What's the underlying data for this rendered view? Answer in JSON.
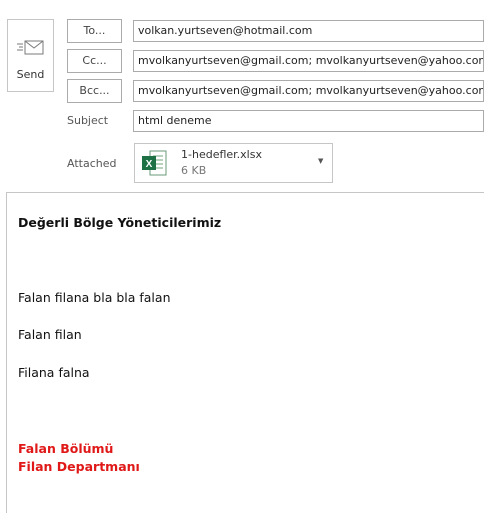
{
  "send": {
    "label": "Send",
    "icon": "send-envelope-icon"
  },
  "fields": {
    "to": {
      "button": "To...",
      "value": "volkan.yurtseven@hotmail.com"
    },
    "cc": {
      "button": "Cc...",
      "value": "mvolkanyurtseven@gmail.com; mvolkanyurtseven@yahoo.com.tr"
    },
    "bcc": {
      "button": "Bcc...",
      "value": "mvolkanyurtseven@gmail.com; mvolkanyurtseven@yahoo.com.tr"
    },
    "subject": {
      "label": "Subject",
      "value": "html deneme"
    },
    "attached": {
      "label": "Attached"
    }
  },
  "attachment": {
    "name": "1-hedefler.xlsx",
    "size": "6 KB",
    "icon": "excel-file-icon"
  },
  "message": {
    "greeting": "Değerli Bölge Yöneticilerimiz",
    "lines": [
      "Falan filana bla bla falan",
      "Falan filan",
      "Filana falna"
    ],
    "signature": [
      "Falan Bölümü",
      "Filan Departmanı"
    ]
  },
  "colors": {
    "signature": "#e01818",
    "excel_green": "#1e7145"
  }
}
